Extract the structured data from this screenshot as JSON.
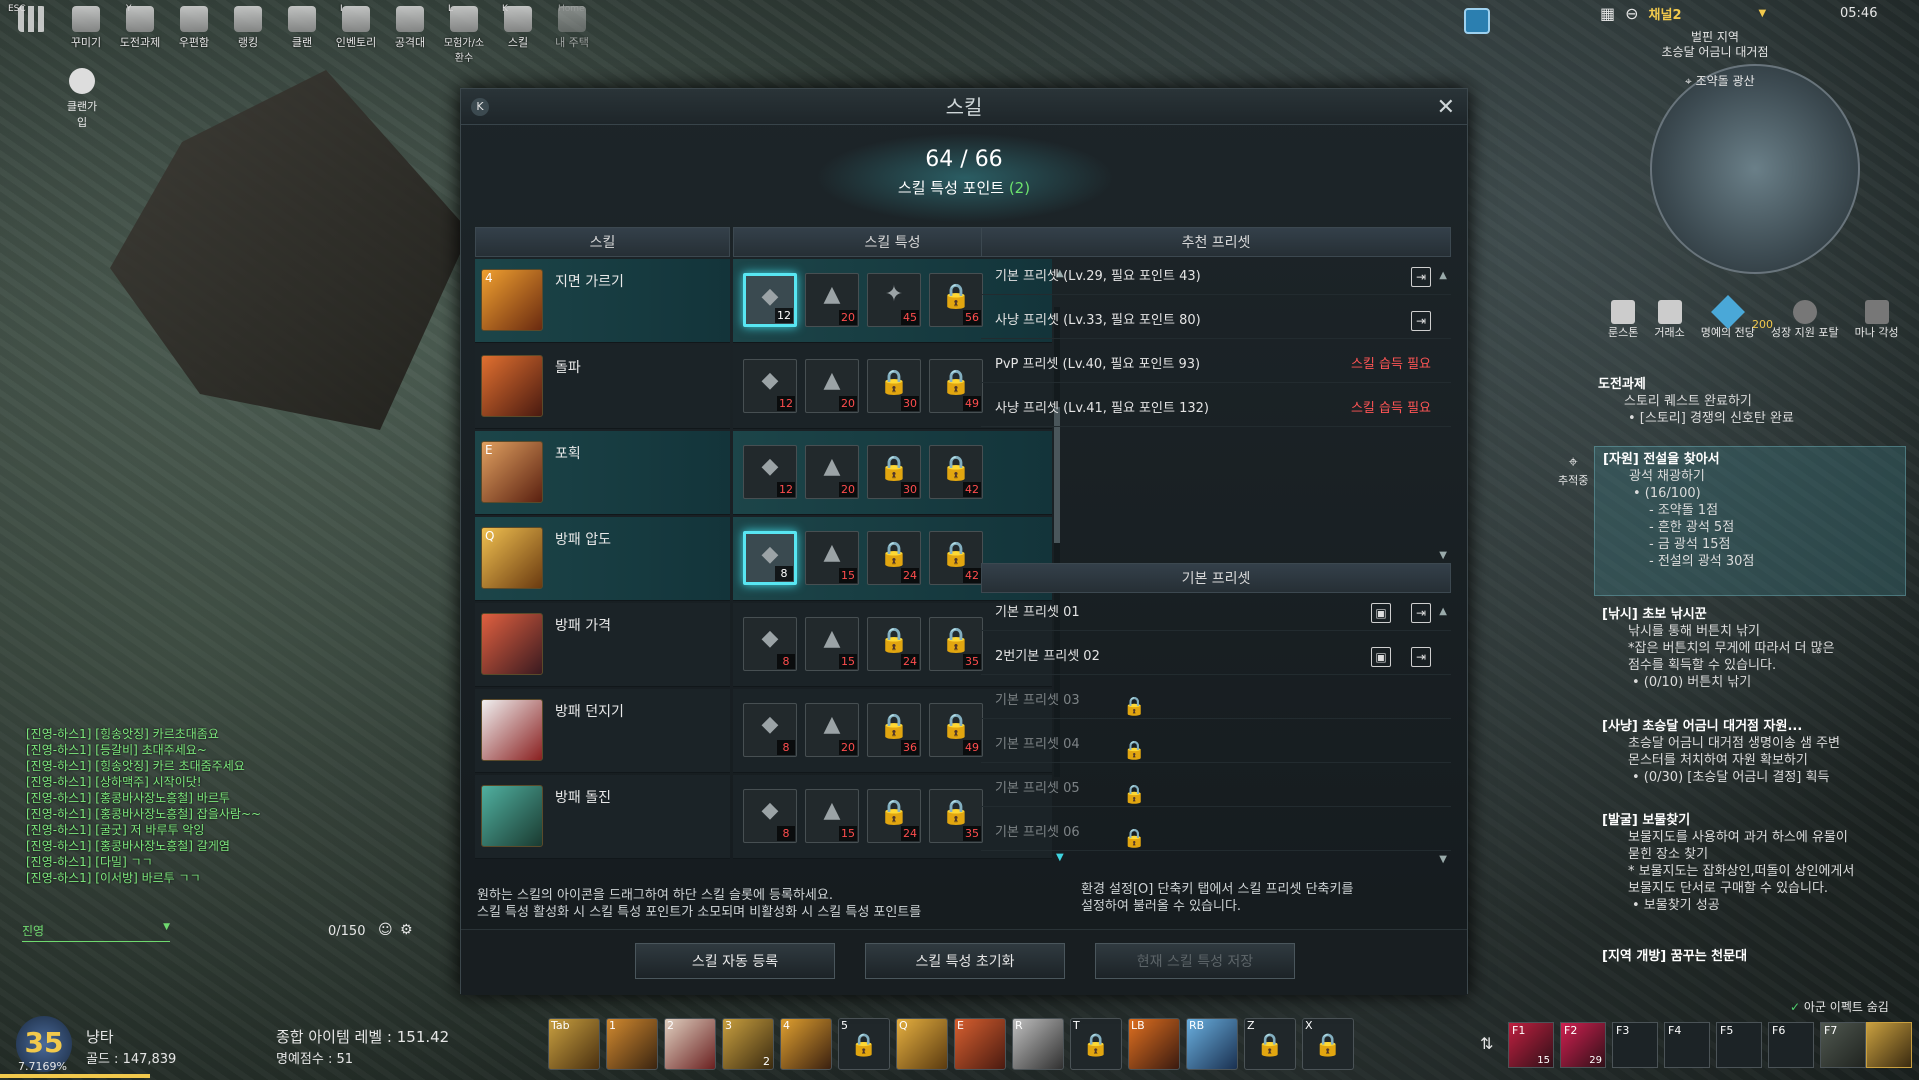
{
  "top_menu": [
    {
      "key": "ESC",
      "label": ""
    },
    {
      "key": "",
      "label": "꾸미기"
    },
    {
      "key": "Y",
      "label": "도전과제"
    },
    {
      "key": "",
      "label": "우편함"
    },
    {
      "key": "",
      "label": "랭킹"
    },
    {
      "key": "",
      "label": "클랜"
    },
    {
      "key": "I",
      "label": "인벤토리"
    },
    {
      "key": "",
      "label": "공격대"
    },
    {
      "key": "L",
      "label": "모험가/소환수"
    },
    {
      "key": "K",
      "label": "스킬"
    },
    {
      "key": "Home",
      "label": "내 주택"
    }
  ],
  "clan_join": "클랜가입",
  "channel": "채널2",
  "clock": "05:46",
  "region": {
    "line1": "벌핀 지역",
    "line2": "초승달 어금니 대거점",
    "poi": "조약돌 광산"
  },
  "minimap_value": "200",
  "right_icons": [
    "룬스톤",
    "거래소",
    "명예의 전당",
    "성장 지원 포탈",
    "마나 각성"
  ],
  "skill_window": {
    "hotkey": "K",
    "title": "스킬",
    "points": "64 / 66",
    "points_label": "스킬 특성 포인트",
    "points_available": "(2)",
    "col_skill": "스킬",
    "col_trait": "스킬 특성",
    "skills": [
      {
        "hotkey": "4",
        "name": "지면 가르기",
        "traits": [
          "12",
          "20",
          "45",
          "56"
        ]
      },
      {
        "hotkey": "",
        "name": "돌파",
        "traits": [
          "12",
          "20",
          "30",
          "49"
        ]
      },
      {
        "hotkey": "E",
        "name": "포획",
        "traits": [
          "12",
          "20",
          "30",
          "42"
        ]
      },
      {
        "hotkey": "Q",
        "name": "방패 압도",
        "traits": [
          "8",
          "15",
          "24",
          "42"
        ]
      },
      {
        "hotkey": "",
        "name": "방패 가격",
        "traits": [
          "8",
          "15",
          "24",
          "35"
        ]
      },
      {
        "hotkey": "",
        "name": "방패 던지기",
        "traits": [
          "8",
          "20",
          "36",
          "49"
        ]
      },
      {
        "hotkey": "",
        "name": "방패 돌진",
        "traits": [
          "8",
          "15",
          "24",
          "35"
        ]
      }
    ],
    "recommended_header": "추천 프리셋",
    "recommended": [
      {
        "name": "기본 프리셋 (Lv.29, 필요 포인트 43)",
        "req": ""
      },
      {
        "name": "사냥 프리셋 (Lv.33, 필요 포인트 80)",
        "req": ""
      },
      {
        "name": "PvP 프리셋 (Lv.40, 필요 포인트 93)",
        "req": "스킬 습득 필요"
      },
      {
        "name": "사냥 프리셋 (Lv.41, 필요 포인트 132)",
        "req": "스킬 습득 필요"
      }
    ],
    "basic_header": "기본 프리셋",
    "basic": [
      "기본 프리셋 01",
      "2번기본 프리셋 02",
      "기본 프리셋 03",
      "기본 프리셋 04",
      "기본 프리셋 05",
      "기본 프리셋 06"
    ],
    "hint_left_1": "원하는 스킬의 아이콘을 드래그하여 하단 스킬 슬롯에 등록하세요.",
    "hint_left_2": "스킬 특성 활성화 시 스킬 특성 포인트가 소모되며 비활성화 시 스킬 특성 포인트를",
    "hint_right_1": "환경 설정[O] 단축키 탭에서 스킬 프리셋 단축키를",
    "hint_right_2": "설정하여 불러올 수 있습니다.",
    "btn_auto": "스킬 자동 등록",
    "btn_reset": "스킬 특성 초기화",
    "btn_save": "현재 스킬 특성 저장"
  },
  "quests": {
    "header": "도전과제",
    "story_title": "스토리 퀘스트 완료하기",
    "story_sub": "• [스토리] 경쟁의 신호탄 완료",
    "tracking": "추적중",
    "q1_title": "[자원] 전설을 찾아서",
    "q1_lines": [
      "광석 채광하기",
      "• (16/100)",
      "- 조약돌 1점",
      "- 흔한 광석 5점",
      "- 금 광석 15점",
      "- 전설의 광석 30점"
    ],
    "q2_title": "[낚시] 초보 낚시꾼",
    "q2_lines": [
      "낚시를 통해 버튼치 낚기",
      "*잡은 버튼치의 무게에 따라서 더 많은",
      "점수를 획득할 수 있습니다.",
      "• (0/10) 버튼치 낚기"
    ],
    "q3_title": "[사냥] 초승달 어금니 대거점 자원...",
    "q3_lines": [
      "초승달 어금니 대거점 생명이송 샘 주변",
      "몬스터를 처치하여 자원 확보하기",
      "• (0/30) [초승달 어금니 결정] 획득"
    ],
    "q4_title": "[발굴] 보물찾기",
    "q4_lines": [
      "보물지도를 사용하여 과거 하스에 유물이",
      "묻힌 장소 찾기",
      "* 보물지도는 잡화상인,떠돌이 상인에게서",
      "보물지도 단서로 구매할 수 있습니다.",
      "• 보물찾기 성공"
    ],
    "q5_title": "[지역 개방] 꿈꾸는 천문대",
    "hide_effect": "아군 이펙트 숨김"
  },
  "chat": {
    "lines": [
      "[진영-하스1] [힝송앗징] 카르초대좀요",
      "[진영-하스1] [등갈비] 초대주세요~",
      "[진영-하스1] [힝송앗징] 카르 초대줌주세요",
      "[진영-하스1] [상하맥주] 시작이닷!",
      "[진영-하스1] [홍콩바사장노흥철] 바르투",
      "[진영-하스1] [홍콩바사장노흥철] 잡을사람~~",
      "[진영-하스1] [굴굿] 저 바루투 악잉",
      "[진영-하스1] [홍콩바사장노흥철] 갈게염",
      "[진영-하스1] [다밀] ㄱㄱ",
      "[진영-하스1] [이서방] 바르투 ㄱㄱ"
    ],
    "channel": "진영",
    "count": "0/150"
  },
  "player": {
    "level": "35",
    "exp": "7.7169%",
    "name": "냥타",
    "gold": "골드 : 147,839",
    "item_level": "종합 아이템 레벨 : 151.42",
    "honor": "명예점수 : 51"
  },
  "hotbar": [
    {
      "key": "Tab",
      "count": ""
    },
    {
      "key": "1",
      "count": ""
    },
    {
      "key": "2",
      "count": ""
    },
    {
      "key": "3",
      "count": "2"
    },
    {
      "key": "4",
      "count": ""
    },
    {
      "key": "5",
      "count": ""
    },
    {
      "key": "Q",
      "count": ""
    },
    {
      "key": "E",
      "count": ""
    },
    {
      "key": "R",
      "count": ""
    },
    {
      "key": "T",
      "count": ""
    },
    {
      "key": "LB",
      "count": ""
    },
    {
      "key": "RB",
      "count": ""
    },
    {
      "key": "Z",
      "count": ""
    },
    {
      "key": "X",
      "count": ""
    }
  ],
  "fbar": [
    {
      "key": "F1",
      "count": "15"
    },
    {
      "key": "F2",
      "count": "29"
    },
    {
      "key": "F3",
      "count": ""
    },
    {
      "key": "F4",
      "count": ""
    },
    {
      "key": "F5",
      "count": ""
    },
    {
      "key": "F6",
      "count": ""
    },
    {
      "key": "F7",
      "count": ""
    }
  ]
}
